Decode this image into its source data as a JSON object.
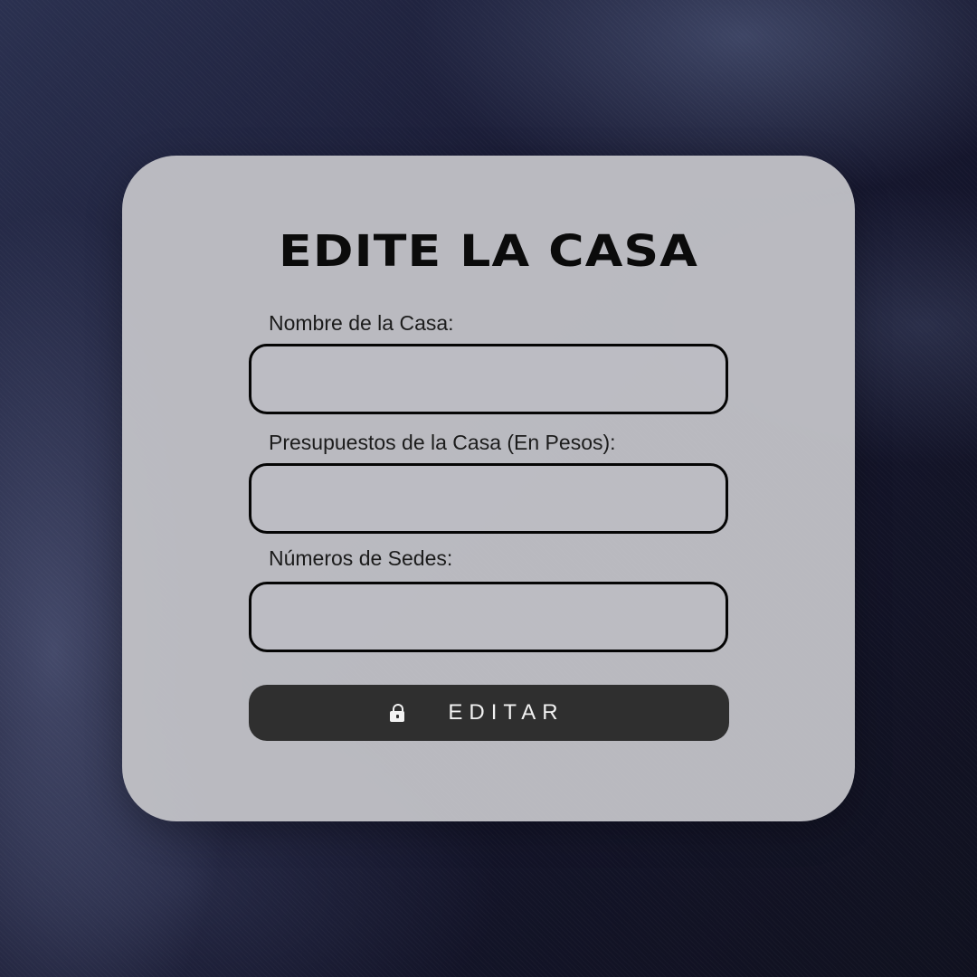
{
  "form": {
    "title": "EDITE LA CASA",
    "fields": [
      {
        "label": "Nombre de la Casa:",
        "value": "",
        "placeholder": ""
      },
      {
        "label": "Presupuestos de la Casa (En Pesos):",
        "value": "",
        "placeholder": ""
      },
      {
        "label": "Números de Sedes:",
        "value": "",
        "placeholder": ""
      }
    ],
    "submit": {
      "label": "EDITAR",
      "icon": "lock-icon"
    }
  },
  "colors": {
    "card_background": "#c1c1c6",
    "field_border": "#050505",
    "button_background": "#2f2f2f",
    "button_text": "#f2f2f2",
    "page_background": "#14142a"
  }
}
